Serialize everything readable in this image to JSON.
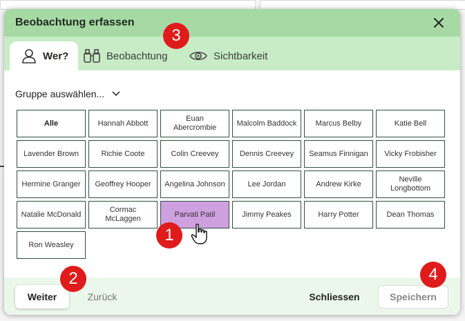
{
  "dialog": {
    "title": "Beobachtung erfassen",
    "close_icon": "close-icon"
  },
  "tabs": [
    {
      "label": "Wer?",
      "icon": "person-icon",
      "active": true
    },
    {
      "label": "Beobachtung",
      "icon": "binoculars-icon",
      "active": false
    },
    {
      "label": "Sichtbarkeit",
      "icon": "eye-icon",
      "active": false
    }
  ],
  "group_select": {
    "label": "Gruppe auswählen...",
    "icon": "chevron-down-icon"
  },
  "people": [
    "Alle",
    "Hannah Abbott",
    "Euan Abercrombie",
    "Malcolm Baddock",
    "Marcus Belby",
    "Katie Bell",
    "Lavender Brown",
    "Richie Coote",
    "Colin Creevey",
    "Dennis Creevey",
    "Seamus Finnigan",
    "Vicky Frobisher",
    "Hermine Granger",
    "Geoffrey Hooper",
    "Angelina Johnson",
    "Lee Jordan",
    "Andrew Kirke",
    "Neville Longbottom",
    "Natalie McDonald",
    "Cormac McLaggen",
    "Parvati Patil",
    "Jimmy Peakes",
    "Harry Potter",
    "Dean Thomas",
    "Ron Weasley"
  ],
  "selected_person": "Parvati Patil",
  "footer": {
    "next": "Weiter",
    "back": "Zurück",
    "close": "Schliessen",
    "save": "Speichern"
  },
  "annotations": [
    "1",
    "2",
    "3",
    "4"
  ],
  "colors": {
    "header": "#a7d9a5",
    "tabbar": "#c8ecc6",
    "selected": "#cfa0df",
    "badge": "#e01b1b"
  }
}
